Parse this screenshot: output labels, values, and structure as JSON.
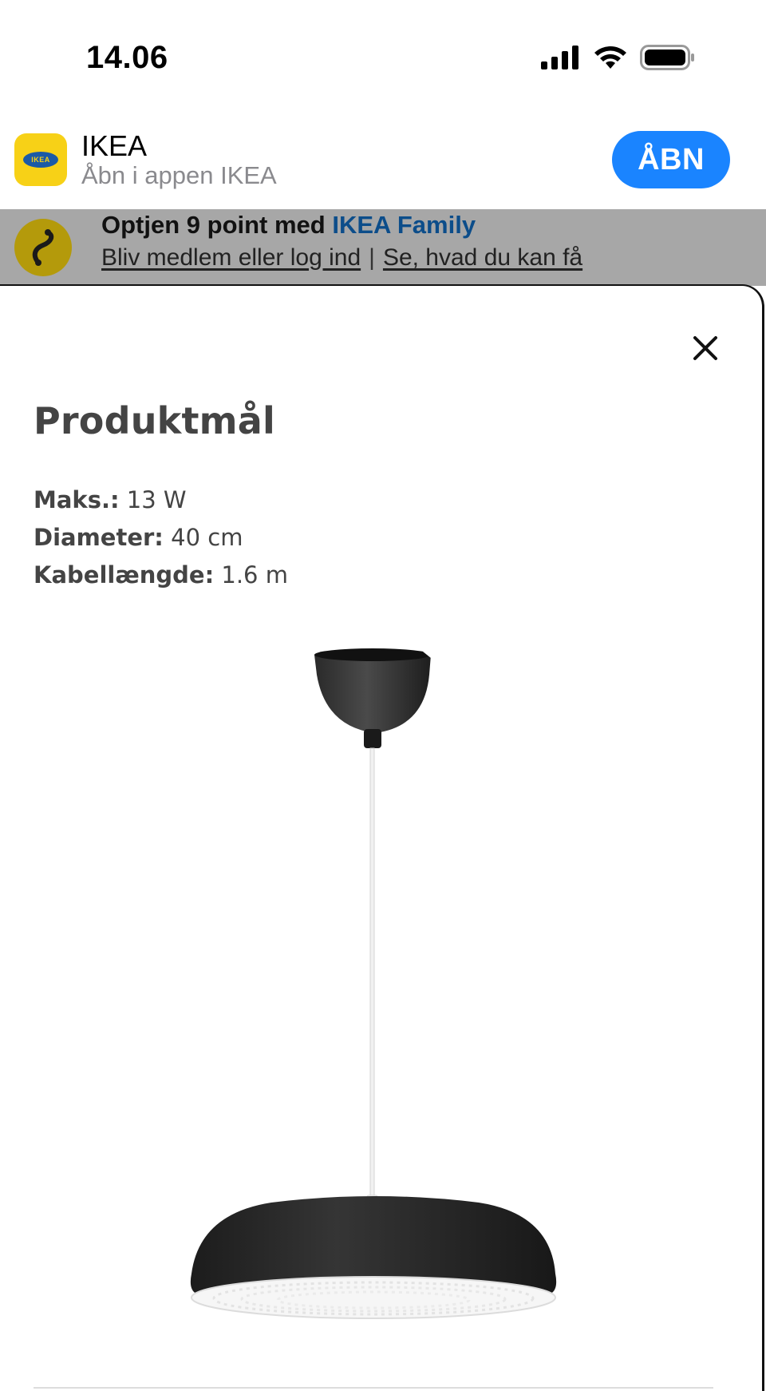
{
  "status_bar": {
    "time": "14.06"
  },
  "app_banner": {
    "app_name": "IKEA",
    "subtitle": "Åbn i appen IKEA",
    "icon_text": "IKEA",
    "open_button": "ÅBN"
  },
  "family_bar": {
    "title_prefix": "Optjen 9 point med ",
    "title_accent": "IKEA Family",
    "link_join": "Bliv medlem eller log ind",
    "separator": "|",
    "link_benefits": "Se, hvad du kan få"
  },
  "sheet": {
    "title": "Produktmål",
    "dimensions": [
      {
        "label": "Maks.:",
        "value": " 13 W"
      },
      {
        "label": "Diameter:",
        "value": " 40 cm"
      },
      {
        "label": "Kabellængde:",
        "value": " 1.6 m"
      }
    ]
  },
  "colors": {
    "accent_blue": "#1a84ff",
    "ikea_yellow": "#f7d117",
    "ikea_blue": "#1b5aa6",
    "family_accent": "#0c4d8a"
  }
}
